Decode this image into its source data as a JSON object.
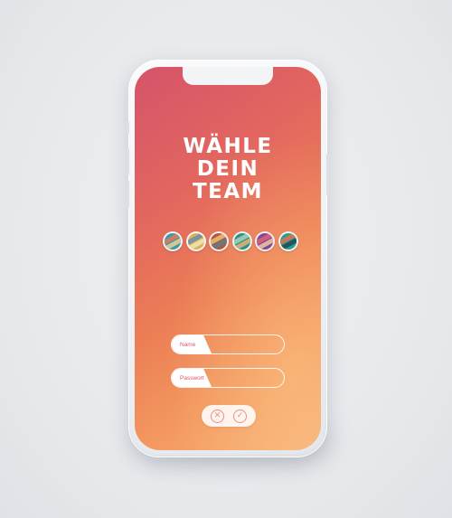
{
  "app": {
    "title_lines": [
      "WÄHLE",
      "DEIN",
      "TEAM"
    ]
  },
  "teams": [
    {
      "icon": "team-badge-1-icon",
      "colors": [
        "#3b9aa6",
        "#e07a5f",
        "#f2cc8f"
      ]
    },
    {
      "icon": "team-badge-2-icon",
      "colors": [
        "#d9b25a",
        "#6a8caf",
        "#f4e3b2"
      ]
    },
    {
      "icon": "team-badge-3-icon",
      "colors": [
        "#b5563d",
        "#e8c170",
        "#5a7d8c"
      ]
    },
    {
      "icon": "team-badge-4-icon",
      "colors": [
        "#2f8f8a",
        "#a8d5ba",
        "#e6b56c"
      ]
    },
    {
      "icon": "team-badge-5-icon",
      "colors": [
        "#7a4a8f",
        "#e0607e",
        "#f6c4a0"
      ]
    },
    {
      "icon": "team-badge-6-icon",
      "colors": [
        "#2a9d8f",
        "#e76f51",
        "#264653"
      ]
    }
  ],
  "form": {
    "name_label": "Name",
    "name_value": "",
    "password_label": "Passwort",
    "password_value": ""
  },
  "actions": {
    "cancel_icon": "close-icon",
    "confirm_icon": "check-icon"
  },
  "colors": {
    "gradient_start": "#d6536a",
    "gradient_end": "#f5b27a",
    "accent": "#e0566a"
  }
}
